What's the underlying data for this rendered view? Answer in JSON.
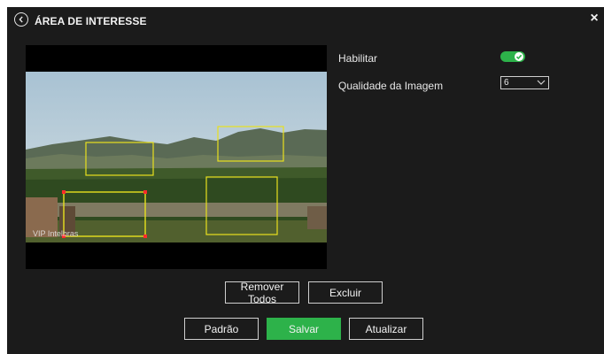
{
  "dialog": {
    "title": "ÁREA DE INTERESSE",
    "back_icon": "back-circle-icon",
    "close_icon": "close-icon",
    "close_glyph": "×"
  },
  "video": {
    "watermark": "VIP Intelbras",
    "roi_color": "#e8e01e",
    "handle_color": "#ff2a2a"
  },
  "settings": {
    "enable_label": "Habilitar",
    "enable_on": true,
    "quality_label": "Qualidade da Imagem",
    "quality_value": "6"
  },
  "buttons": {
    "remove_all": "Remover Todos",
    "delete": "Excluir",
    "default": "Padrão",
    "save": "Salvar",
    "refresh": "Atualizar"
  },
  "colors": {
    "panel_bg": "#1b1b1b",
    "accent_green": "#2db24a",
    "text": "#f2f2f2"
  }
}
